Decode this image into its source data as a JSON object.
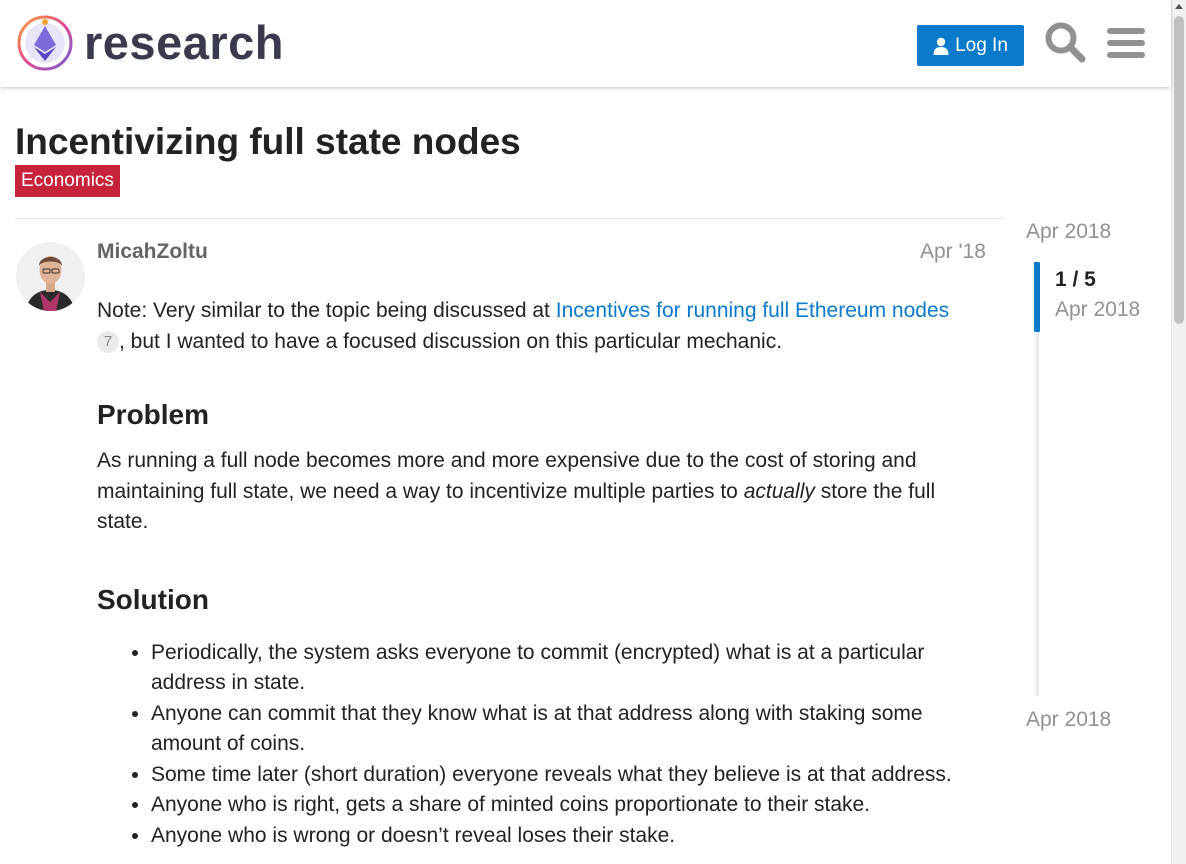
{
  "header": {
    "site_name": "research",
    "login_label": "Log In",
    "icons": [
      "logo-icon",
      "user-icon",
      "search-icon",
      "hamburger-menu-icon"
    ],
    "accent_color": "#0a7aca"
  },
  "topic": {
    "title": "Incentivizing full state nodes",
    "category": "Economics",
    "category_color": "#c6243a"
  },
  "post": {
    "username": "MicahZoltu",
    "date": "Apr '18",
    "intro_prefix": "Note: Very similar to the topic being discussed at ",
    "intro_link": "Incentives for running full Ethereum nodes",
    "intro_link_clicks": "7",
    "intro_suffix": ", but I wanted to have a focused discussion on this particular mechanic.",
    "problem_heading": "Problem",
    "problem_before": "As running a full node becomes more and more expensive due to the cost of storing and maintaining full state, we need a way to incentivize multiple parties to ",
    "problem_emphasis": "actually",
    "problem_after": " store the full state.",
    "solution_heading": "Solution",
    "solution_items": [
      "Periodically, the system asks everyone to commit (encrypted) what is at a particular address in state.",
      "Anyone can commit that they know what is at that address along with staking some amount of coins.",
      "Some time later (short duration) everyone reveals what they believe is at that address.",
      "Anyone who is right, gets a share of minted coins proportionate to their stake.",
      "Anyone who is wrong or doesn’t reveal loses their stake."
    ]
  },
  "timeline": {
    "start_date": "Apr 2018",
    "position": "1 / 5",
    "position_date": "Apr 2018",
    "end_date": "Apr 2018",
    "progress": 0.2
  }
}
